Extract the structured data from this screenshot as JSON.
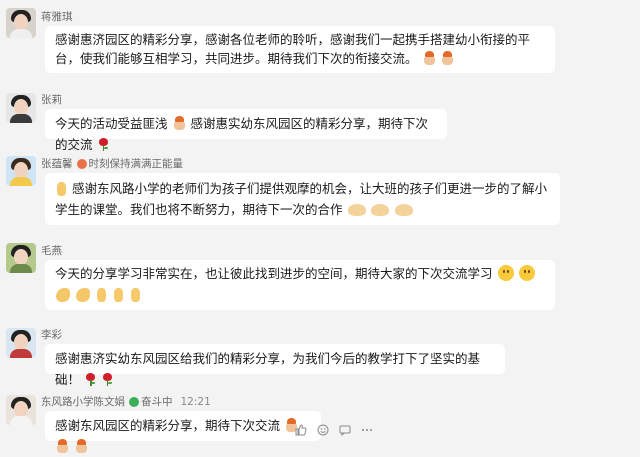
{
  "messages": [
    {
      "name": "蒋雅琪",
      "text": "感谢惠济园区的精彩分享，感谢各位老师的聆听，感谢我们一起携手搭建幼小衔接的平台，使我们能够互相学习，共同进步。期待我们下次的衔接交流。",
      "avatar": "avatar-woman"
    },
    {
      "name": "张莉",
      "text_a": "今天的活动受益匪浅",
      "text_b": "感谢惠实幼东风园区的精彩分享，期待下次的交流",
      "avatar": "avatar-woman"
    },
    {
      "name": "张蕴馨",
      "status": "时刻保持满满正能量",
      "text": "感谢东风路小学的老师们为孩子们提供观摩的机会，让大班的孩子们更进一步的了解小学生的课堂。我们也将不断努力，期待下一次的合作",
      "avatar": "avatar-girl"
    },
    {
      "name": "毛燕",
      "text": "今天的分享学习非常实在，也让彼此找到进步的空间，期待大家的下次交流学习",
      "avatar": "avatar-outdoor"
    },
    {
      "name": "李彩",
      "text": "感谢惠济实幼东风园区给我们的精彩分享，为我们今后的教学打下了坚实的基础！",
      "avatar": "avatar-woman-red"
    },
    {
      "name": "东风路小学陈文娟",
      "status": "奋斗中",
      "time": "12:21",
      "text": "感谢东风园区的精彩分享，期待下次交流",
      "avatar": "avatar-woman-plain"
    }
  ],
  "colors": {
    "background": "#f3f3f3",
    "bubble": "#ffffff",
    "name_text": "#6a6a6a",
    "status_dot": "#e8734a",
    "status_dot_2": "#3cae5a"
  },
  "icons": {
    "toolbar": [
      "thumbs-up-icon",
      "smile-icon",
      "reply-icon",
      "more-icon"
    ]
  }
}
